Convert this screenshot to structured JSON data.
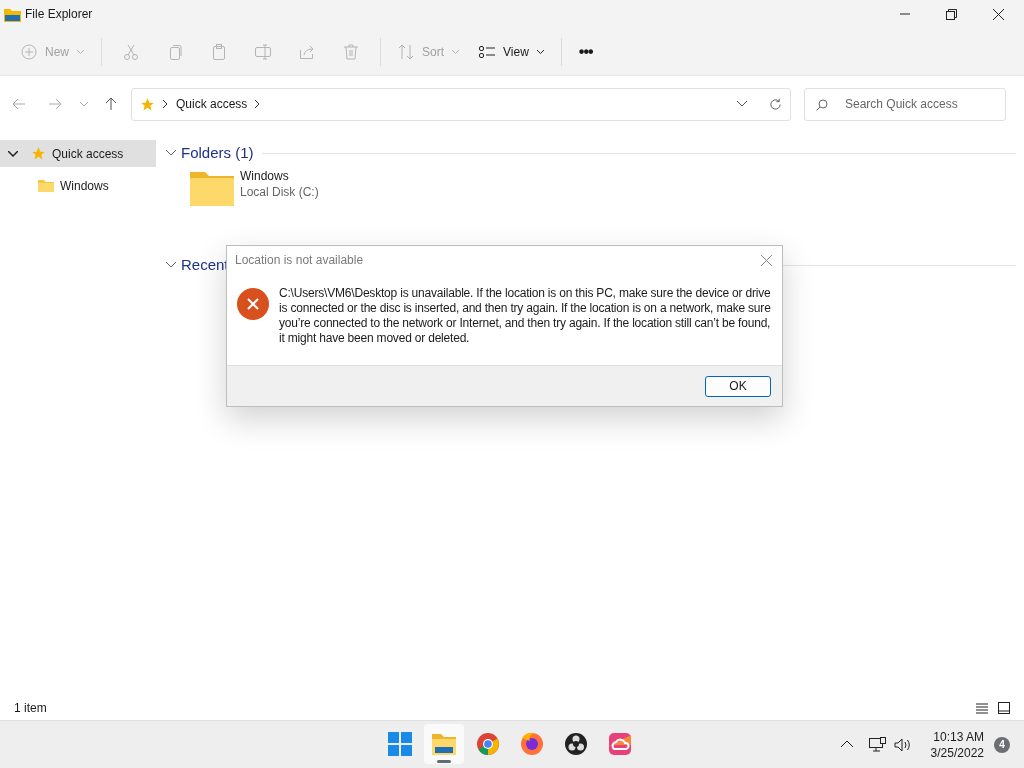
{
  "window": {
    "title": "File Explorer"
  },
  "toolbar": {
    "items": [
      {
        "label": "New",
        "dropdown": true,
        "disabled": true
      },
      {
        "disabled": true
      },
      {
        "disabled": true
      },
      {
        "disabled": true
      },
      {
        "disabled": true
      },
      {
        "disabled": true
      },
      {
        "disabled": true
      },
      {
        "label": "Sort",
        "dropdown": true,
        "disabled": true
      },
      {
        "label": "View",
        "dropdown": true,
        "disabled": false
      },
      {
        "label": "•••",
        "disabled": false
      }
    ]
  },
  "address_bar": {
    "path": [
      "Quick access"
    ],
    "search_placeholder": "Search Quick access"
  },
  "sidebar": {
    "items": [
      {
        "label": "Quick access",
        "expanded": true,
        "selected": true,
        "children": [
          {
            "label": "Windows",
            "selected": false
          }
        ]
      }
    ]
  },
  "groups": [
    {
      "title": "Folders (1)",
      "expanded": true,
      "items": [
        {
          "name": "Windows",
          "detail": "Local Disk (C:)"
        }
      ]
    },
    {
      "title": "Recent",
      "expanded": true
    }
  ],
  "dialog": {
    "title": "Location is not available",
    "message": "C:\\Users\\VM6\\Desktop is unavailable. If the location is on this PC, make sure the device or drive is connected or the disc is inserted, and then try again. If the location is on a network, make sure you’re connected to the network or Internet, and then try again. If the location still can’t be found, it might have been moved or deleted.",
    "button": "OK"
  },
  "status_bar": {
    "text": "1 item"
  },
  "taskbar": {
    "apps": [
      {
        "selected": false
      },
      {
        "selected": true
      },
      {
        "selected": false
      },
      {
        "selected": false
      },
      {
        "selected": false
      },
      {
        "selected": false
      }
    ],
    "time": "10:13 AM",
    "date": "3/25/2022",
    "notifications": "4"
  }
}
